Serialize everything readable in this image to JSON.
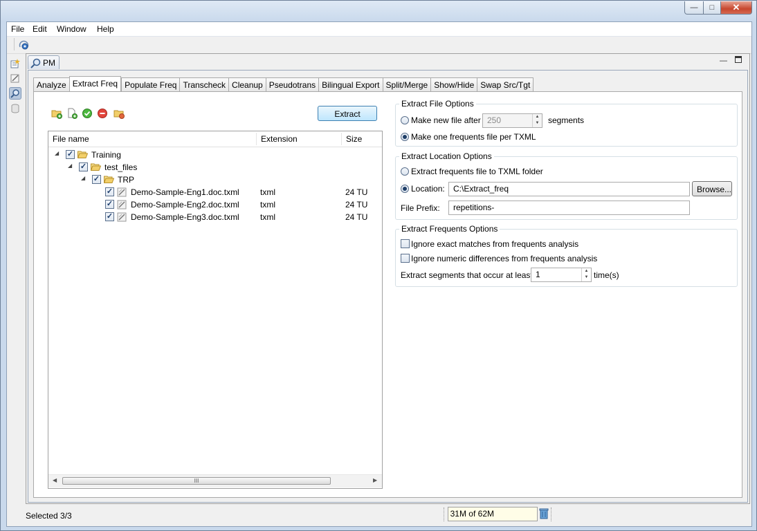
{
  "menu": {
    "file": "File",
    "edit": "Edit",
    "window": "Window",
    "help": "Help"
  },
  "view": {
    "tab_label": "PM"
  },
  "tabs": [
    {
      "label": "Analyze"
    },
    {
      "label": "Extract Freq"
    },
    {
      "label": "Populate Freq"
    },
    {
      "label": "Transcheck"
    },
    {
      "label": "Cleanup"
    },
    {
      "label": "Pseudotrans"
    },
    {
      "label": "Bilingual Export"
    },
    {
      "label": "Split/Merge"
    },
    {
      "label": "Show/Hide"
    },
    {
      "label": "Swap Src/Tgt"
    }
  ],
  "active_tab": "Extract Freq",
  "extract_button": "Extract",
  "tree": {
    "columns": {
      "name": "File name",
      "ext": "Extension",
      "size": "Size"
    },
    "folders": {
      "training": "Training",
      "test_files": "test_files",
      "trp": "TRP"
    },
    "files": [
      {
        "name": "Demo-Sample-Eng1.doc.txml",
        "ext": "txml",
        "size": "24 TU"
      },
      {
        "name": "Demo-Sample-Eng2.doc.txml",
        "ext": "txml",
        "size": "24 TU"
      },
      {
        "name": "Demo-Sample-Eng3.doc.txml",
        "ext": "txml",
        "size": "24 TU"
      }
    ],
    "scroll_grip": "III"
  },
  "file_options": {
    "title": "Extract File Options",
    "new_file_label": "Make new file after",
    "new_file_value": "250",
    "segments_label": "segments",
    "one_file_label": "Make one frequents file per TXML",
    "selected": "one_file"
  },
  "location_options": {
    "title": "Extract Location Options",
    "to_folder_label": "Extract frequents file to TXML folder",
    "location_label": "Location:",
    "location_value": "C:\\Extract_freq",
    "browse_label": "Browse...",
    "prefix_label": "File Prefix:",
    "prefix_value": "repetitions-",
    "selected": "location"
  },
  "frequents_options": {
    "title": "Extract Frequents Options",
    "ignore_exact_label": "Ignore exact matches from frequents analysis",
    "ignore_numeric_label": "Ignore numeric differences from frequents analysis",
    "occur_label": "Extract segments that occur at least",
    "occur_value": "1",
    "times_label": "time(s)",
    "ignore_exact_checked": false,
    "ignore_numeric_checked": false
  },
  "status": {
    "selected": "Selected 3/3",
    "memory": "31M of 62M"
  },
  "colors": {
    "accent": "#3c7fb1",
    "title_bar": "#c9d9ec",
    "close_button": "#c7472e",
    "memory_bg": "#fffde7"
  },
  "icons": {
    "toolbar": [
      "refresh-gear-icon"
    ],
    "sidebar": [
      "new-project-icon",
      "edit-icon",
      "pm-search-icon",
      "database-icon"
    ],
    "content_toolbar": [
      "add-folder-icon",
      "add-file-icon",
      "check-all-icon",
      "remove-icon",
      "folder-settings-icon"
    ]
  }
}
